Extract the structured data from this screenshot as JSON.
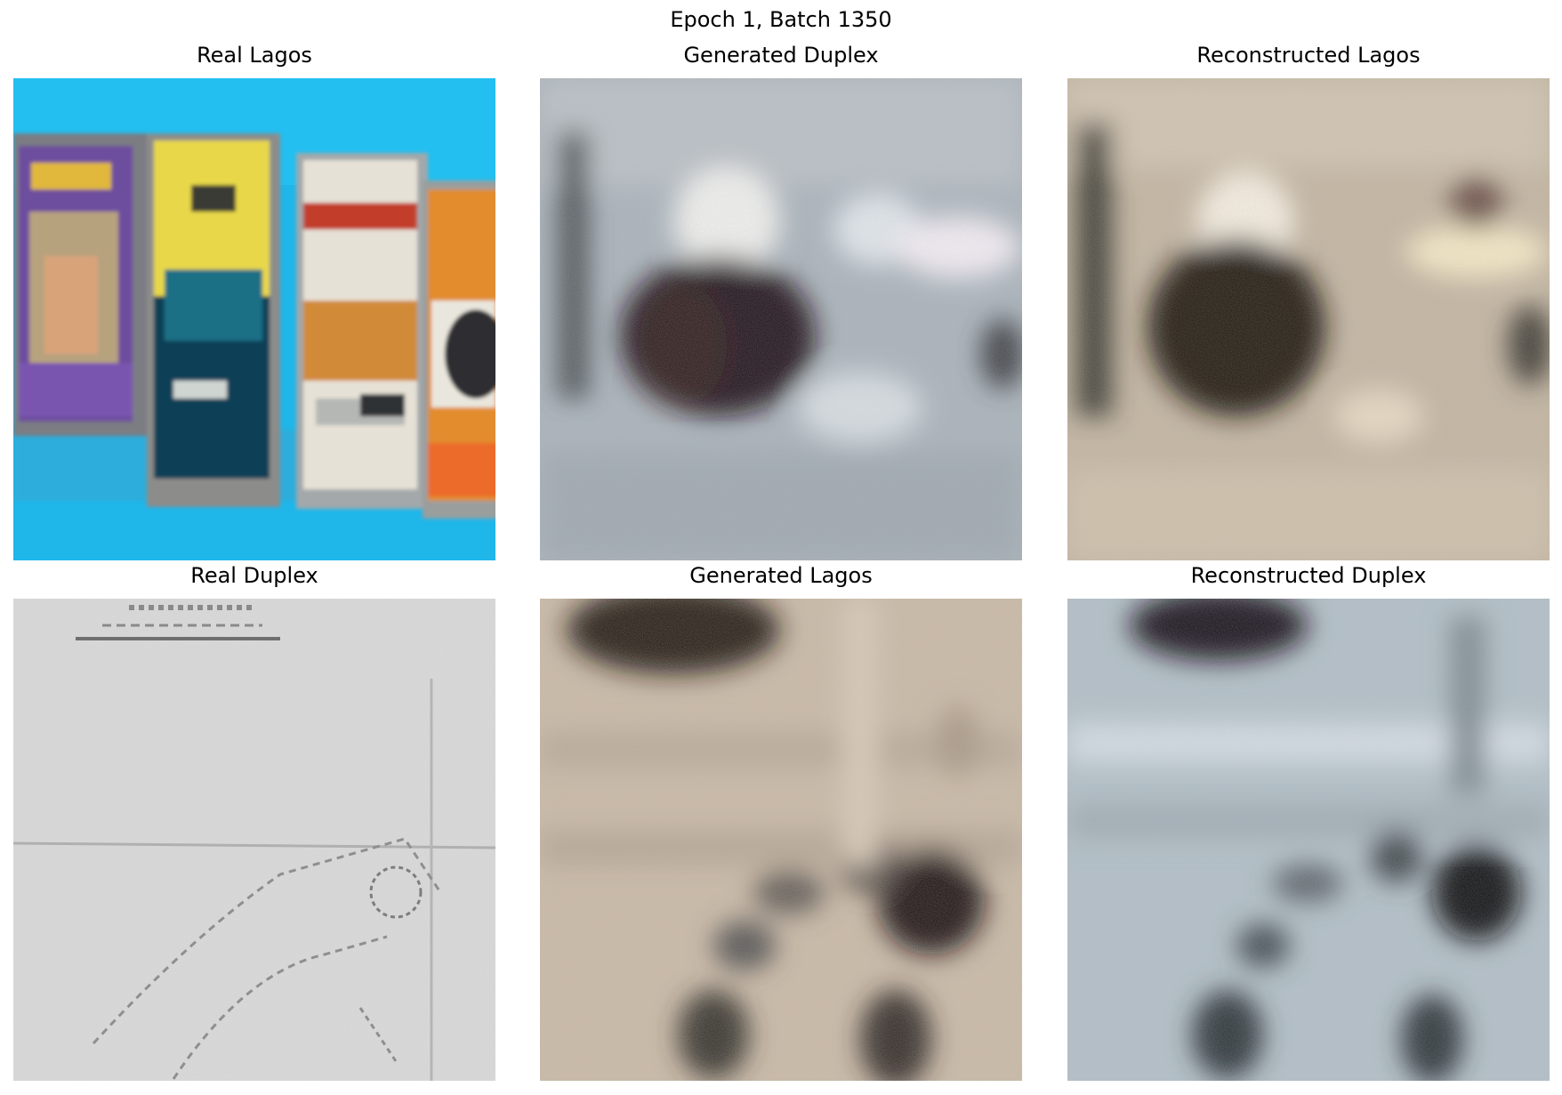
{
  "figure": {
    "suptitle": "Epoch 1, Batch 1350"
  },
  "panels": [
    {
      "title": "Real Lagos",
      "content": "photo of several cassette tape cases on a blue background"
    },
    {
      "title": "Generated Duplex",
      "content": "noisy grey-blue generated image with dark blob in center"
    },
    {
      "title": "Reconstructed Lagos",
      "content": "noisy beige reconstructed image with dark blob in center"
    },
    {
      "title": "Real Duplex",
      "content": "grey scanned floor-plan sketch with faint lines"
    },
    {
      "title": "Generated Lagos",
      "content": "noisy beige generated image with dark blobs at top and right"
    },
    {
      "title": "Reconstructed Duplex",
      "content": "noisy blue-grey reconstructed image with dark blobs"
    }
  ],
  "colors": {
    "lagos_background_blue": "#1fb6ea",
    "duplex_paper_grey": "#d9d9d9",
    "generated_beige": "#c9bba6",
    "generated_grey_blue": "#a9b3bb"
  }
}
